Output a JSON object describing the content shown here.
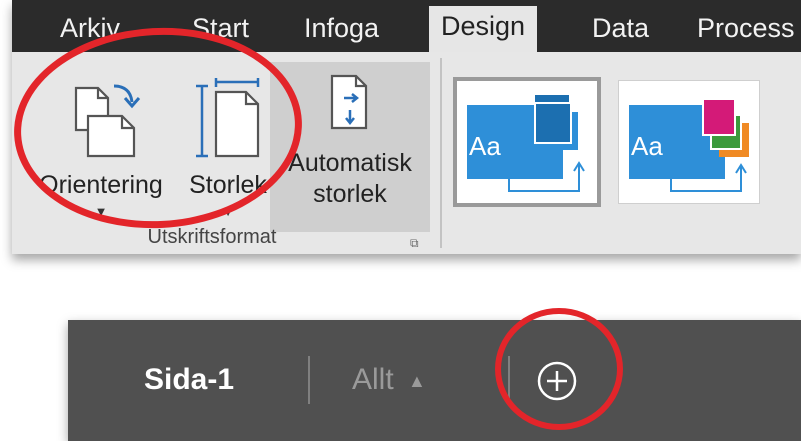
{
  "ribbon": {
    "tabs": [
      {
        "label": "Arkiv",
        "active": false
      },
      {
        "label": "Start",
        "active": false
      },
      {
        "label": "Infoga",
        "active": false
      },
      {
        "label": "Design",
        "active": true
      },
      {
        "label": "Data",
        "active": false
      },
      {
        "label": "Process",
        "active": false
      }
    ],
    "page_setup_group": {
      "label": "Utskriftsformat",
      "orientation": {
        "label": "Orientering",
        "icon": "page-orientation-icon"
      },
      "size": {
        "label": "Storlek",
        "icon": "page-size-icon"
      },
      "auto_size": {
        "label_line1": "Automatisk",
        "label_line2": "storlek",
        "icon": "auto-size-icon"
      }
    },
    "themes": [
      {
        "sample": "Aa",
        "accent": "#2e8fd8",
        "selected": true
      },
      {
        "sample": "Aa",
        "accent": "#2e8fd8",
        "selected": false
      }
    ]
  },
  "page_tabs": {
    "current_page": "Sida-1",
    "all_label": "Allt",
    "add_icon": "add-page-icon"
  },
  "colors": {
    "annotation_red": "#e3252a",
    "tab_bar": "#2b2b2b",
    "ribbon_body": "#e7e7e7",
    "page_bar": "#505050",
    "theme_blue": "#2e8fd8",
    "theme_magenta": "#d41a78",
    "theme_green": "#3c9a3c",
    "theme_orange": "#f08a24"
  }
}
